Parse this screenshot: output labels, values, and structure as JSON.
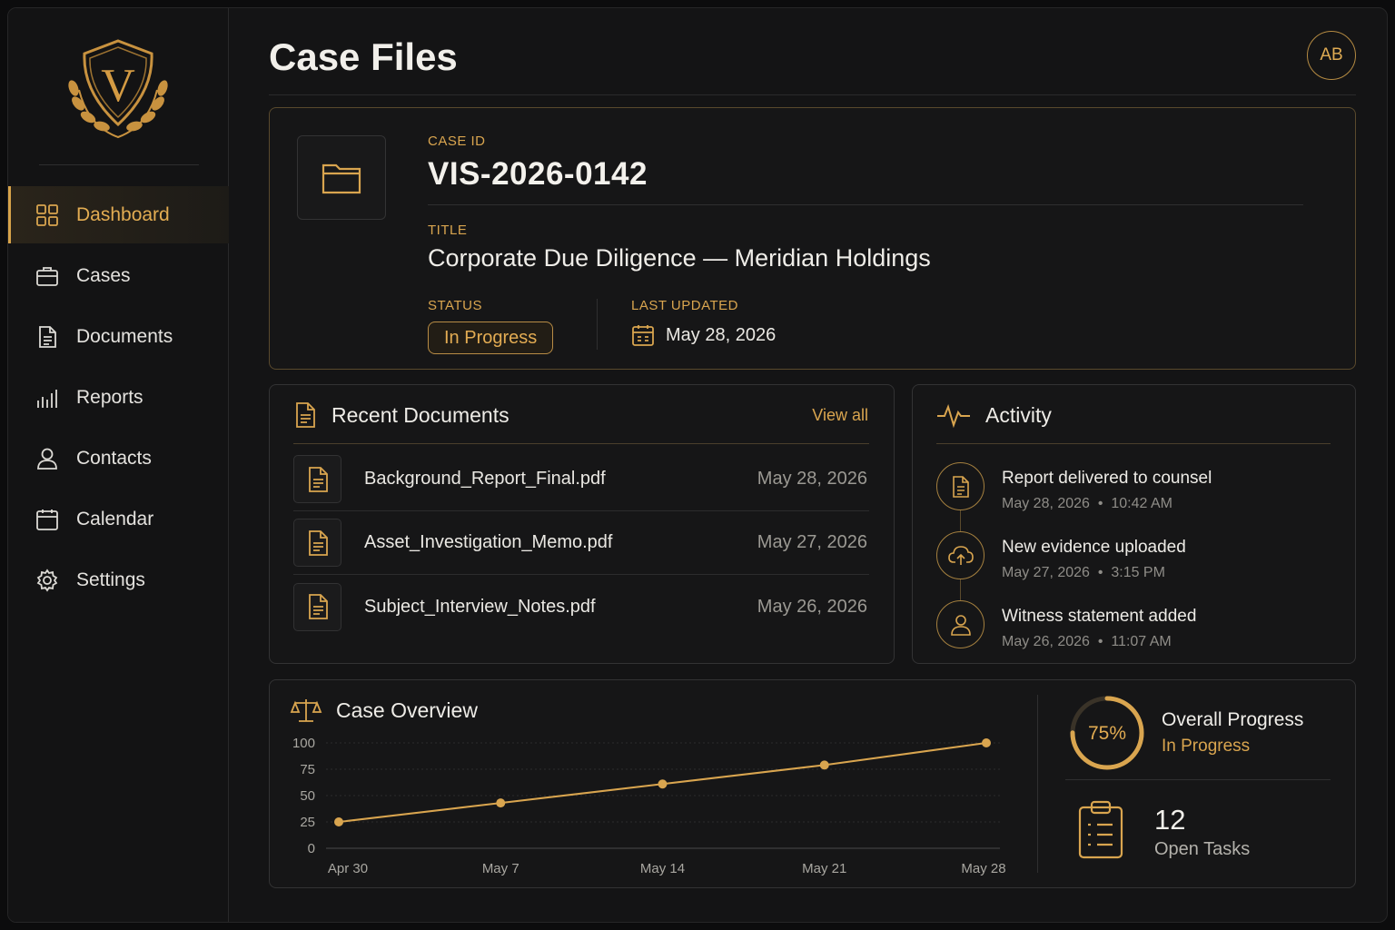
{
  "app": {
    "brand_letter": "V"
  },
  "sidebar": {
    "items": [
      {
        "label": "Dashboard",
        "icon": "grid-icon",
        "active": true
      },
      {
        "label": "Cases",
        "icon": "briefcase-icon"
      },
      {
        "label": "Documents",
        "icon": "document-icon"
      },
      {
        "label": "Reports",
        "icon": "bar-chart-icon"
      },
      {
        "label": "Contacts",
        "icon": "user-icon"
      },
      {
        "label": "Calendar",
        "icon": "calendar-icon"
      },
      {
        "label": "Settings",
        "icon": "gear-icon"
      }
    ]
  },
  "header": {
    "title": "Case Files",
    "avatar_initials": "AB"
  },
  "case": {
    "id_label": "CASE ID",
    "id": "VIS-2026-0142",
    "title_label": "TITLE",
    "title": "Corporate Due Diligence — Meridian Holdings",
    "status_label": "STATUS",
    "status": "In Progress",
    "updated_label": "LAST UPDATED",
    "updated": "May 28, 2026"
  },
  "documents": {
    "title": "Recent Documents",
    "view_all": "View all",
    "rows": [
      {
        "name": "Background_Report_Final.pdf",
        "date": "May 28, 2026"
      },
      {
        "name": "Asset_Investigation_Memo.pdf",
        "date": "May 27, 2026"
      },
      {
        "name": "Subject_Interview_Notes.pdf",
        "date": "May 26, 2026"
      }
    ]
  },
  "activity": {
    "title": "Activity",
    "items": [
      {
        "title": "Report delivered to counsel",
        "date": "May 28, 2026",
        "time": "10:42 AM",
        "icon": "document-icon"
      },
      {
        "title": "New evidence uploaded",
        "date": "May 27, 2026",
        "time": "3:15 PM",
        "icon": "cloud-upload-icon"
      },
      {
        "title": "Witness statement added",
        "date": "May 26, 2026",
        "time": "11:07 AM",
        "icon": "user-icon"
      }
    ],
    "separator": "•"
  },
  "overview": {
    "title": "Case Overview",
    "progress_value": "75%",
    "progress_fraction": 0.75,
    "progress_title": "Overall Progress",
    "progress_status": "In Progress",
    "tasks_count": "12",
    "tasks_label": "Open Tasks"
  },
  "chart_data": {
    "type": "line",
    "x": [
      "Apr 30",
      "May 7",
      "May 14",
      "May 21",
      "May 28"
    ],
    "x_tick_labels": [
      "Apr 30",
      "May 7",
      "May 14",
      "May 21",
      "May 28"
    ],
    "series": [
      {
        "values": [
          25,
          43,
          61,
          79,
          100
        ]
      }
    ],
    "y_ticks": [
      0,
      25,
      50,
      75,
      100
    ],
    "ylim": [
      0,
      100
    ],
    "grid": true,
    "color": "#d9a54f"
  },
  "colors": {
    "accent": "#d9a54f",
    "background": "#141415"
  }
}
